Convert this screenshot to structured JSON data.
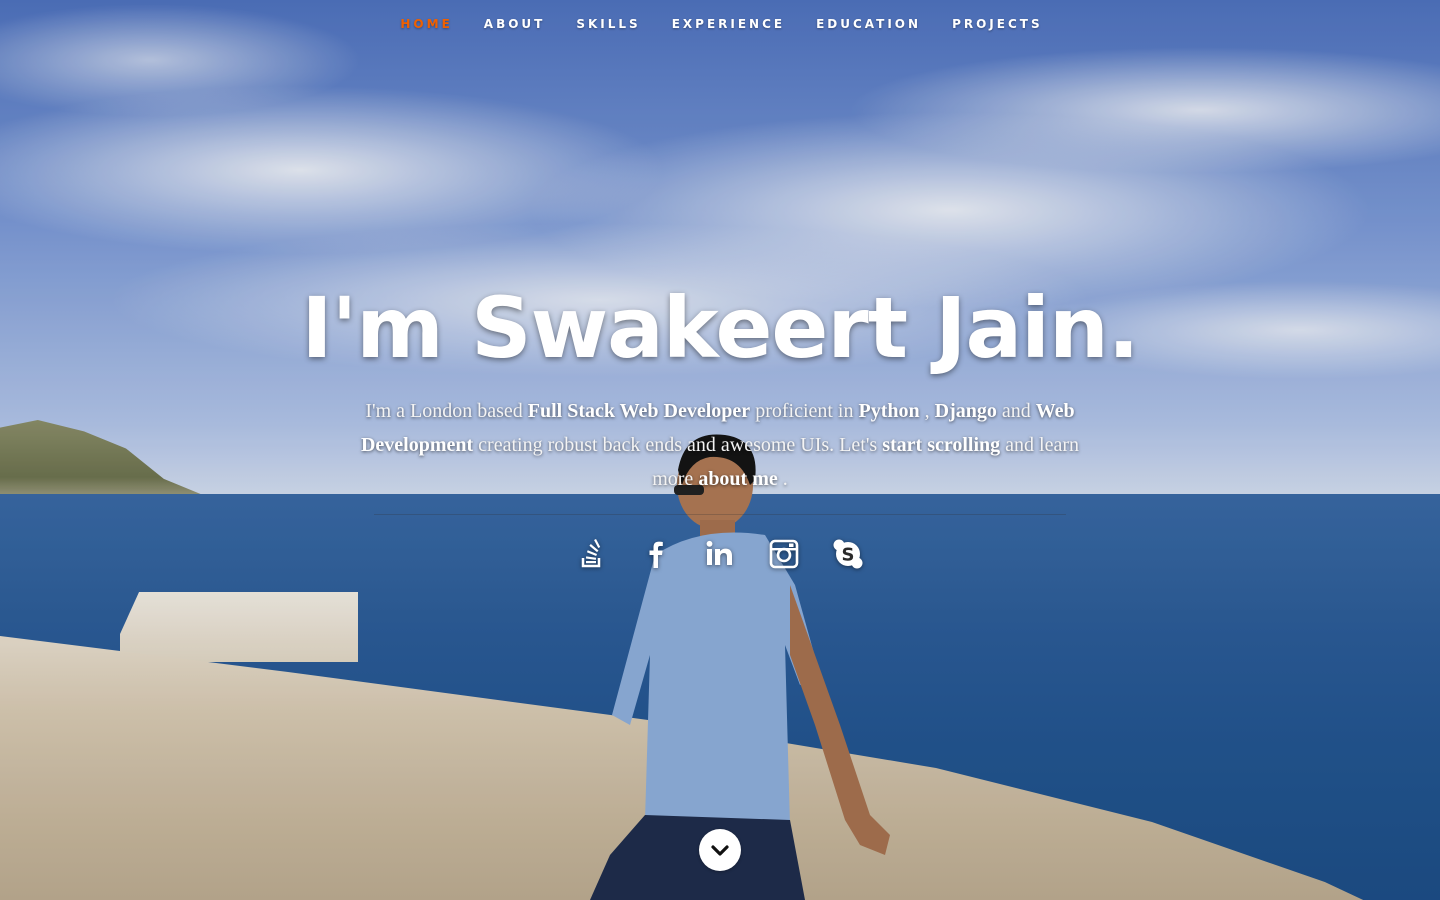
{
  "nav": {
    "items": [
      {
        "label": "HOME",
        "active": true
      },
      {
        "label": "ABOUT",
        "active": false
      },
      {
        "label": "SKILLS",
        "active": false
      },
      {
        "label": "EXPERIENCE",
        "active": false
      },
      {
        "label": "EDUCATION",
        "active": false
      },
      {
        "label": "PROJECTS",
        "active": false
      }
    ]
  },
  "banner": {
    "title": "I'm Swakeert Jain.",
    "lead": {
      "p1": "I'm a London based ",
      "role": "Full Stack Web Developer",
      "p2": " proficient in ",
      "skill1": "Python",
      "p3": " , ",
      "skill2": "Django",
      "p4": " and ",
      "skill3": "Web Development",
      "p5": " creating robust back ends and awesome UIs. Let's ",
      "link1": "start scrolling",
      "p6": " and learn more ",
      "link2": "about me",
      "p7": " ."
    }
  },
  "social": [
    {
      "icon": "stackoverflow-icon"
    },
    {
      "icon": "facebook-icon"
    },
    {
      "icon": "linkedin-icon"
    },
    {
      "icon": "instagram-icon"
    },
    {
      "icon": "skype-icon"
    }
  ],
  "scroll_down": {
    "icon": "chevron-down-icon"
  },
  "colors": {
    "accent": "#F06000",
    "text": "#FFFFFF"
  }
}
